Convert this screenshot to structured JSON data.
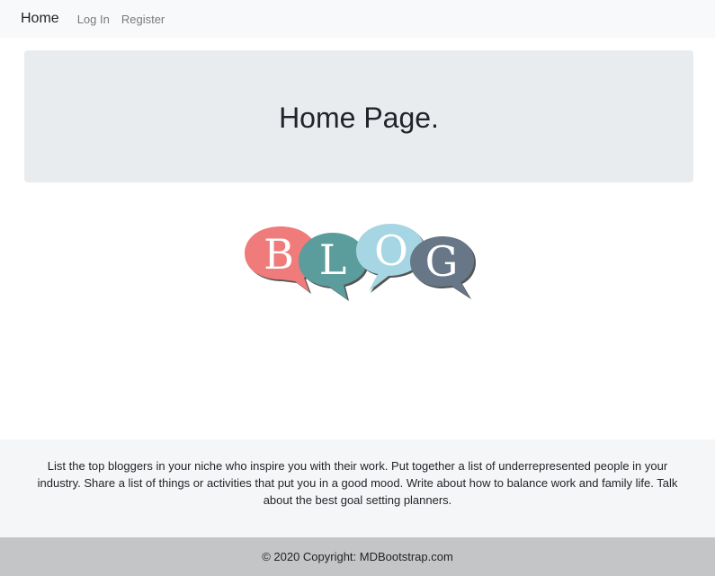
{
  "navbar": {
    "brand": "Home",
    "links": [
      "Log In",
      "Register"
    ]
  },
  "jumbotron": {
    "title": "Home Page."
  },
  "logo": {
    "letters": [
      "B",
      "L",
      "O",
      "G"
    ],
    "colors": [
      "#f07b7b",
      "#5b9c9c",
      "#a6d6e3",
      "#687788"
    ]
  },
  "footer": {
    "text": "List the top bloggers in your niche who inspire you with their work. Put together a list of underrepresented people in your industry. Share a list of things or activities that put you in a good mood. Write about how to balance work and family life. Talk about the best goal setting planners.",
    "copyright": "© 2020 Copyright: MDBootstrap.com"
  }
}
